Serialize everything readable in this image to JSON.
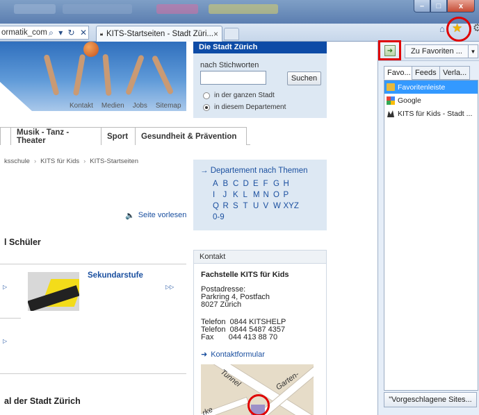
{
  "browser": {
    "address_fragment": "ormatik_com",
    "address_controls": "⌕ ▾ ↻ ✕",
    "tab_title": "KITS-Startseiten - Stadt Züri...",
    "tab_close": "×",
    "home_icon": "⌂",
    "star_icon": "★",
    "gear_icon": "⚙",
    "window_buttons": {
      "minimize": "–",
      "maximize": "□",
      "close": "x"
    }
  },
  "page": {
    "top_links": [
      "Kontakt",
      "Medien",
      "Jobs",
      "Sitemap"
    ],
    "search": {
      "header": "Die Stadt Zürich",
      "label": "nach Stichworten",
      "value": "",
      "button": "Suchen",
      "options": [
        "in der ganzen Stadt",
        "in diesem Departement"
      ],
      "selected_index": 1
    },
    "nav_tabs": [
      "",
      "Musik - Tanz - Theater",
      "Sport",
      "Gesundheit & Prävention"
    ],
    "breadcrumb": [
      "ksschule",
      "KITS für Kids",
      "KITS-Startseiten"
    ],
    "breadcrumb_sep": "›",
    "themes": {
      "title": "→ Departement nach Themen",
      "rows": [
        [
          "A",
          "B",
          "C",
          "D",
          "E",
          "F",
          "G",
          "H"
        ],
        [
          "I",
          "J",
          "K",
          "L",
          "M",
          "N",
          "O",
          "P"
        ],
        [
          "Q",
          "R",
          "S",
          "T",
          "U",
          "V",
          "W",
          "XYZ"
        ],
        [
          "0-9"
        ]
      ]
    },
    "read_aloud": "Seite vorlesen",
    "section_1": "l Schüler",
    "sekundarstufe": "Sekundarstufe",
    "arrow": "▷▷",
    "section_2": "al der Stadt Zürich",
    "kontakt": {
      "header": "Kontakt",
      "name": "Fachstelle KITS für Kids",
      "postal_label": "Postadresse:",
      "address_line1": "Parkring 4, Postfach",
      "address_line2": "8027 Zürich",
      "phone1": "Telefon  0844 KITSHELP",
      "phone2": "Telefon  0844 5487 4357",
      "fax": "Fax       044 413 88 70",
      "form_link": "Kontaktformular"
    },
    "map_labels": [
      "Tunnel",
      "Garten-",
      "rke"
    ]
  },
  "favorites": {
    "add_button": "Zu Favoriten ...",
    "dropdown": "▼",
    "tabs": [
      "Favo...",
      "Feeds",
      "Verla..."
    ],
    "active_tab": 0,
    "items": [
      {
        "label": "Favoritenleiste",
        "icon": "folder-icon",
        "selected": true
      },
      {
        "label": "Google",
        "icon": "google-icon",
        "selected": false
      },
      {
        "label": "KITS für Kids - Stadt ...",
        "icon": "kits-icon",
        "selected": false
      }
    ],
    "suggest_button": "\"Vorgeschlagene Sites..."
  },
  "colors": {
    "highlight_red": "#e00000",
    "selection_blue": "#3399ff",
    "link_blue": "#1a4f9f",
    "header_blue": "#0d4ba6"
  }
}
